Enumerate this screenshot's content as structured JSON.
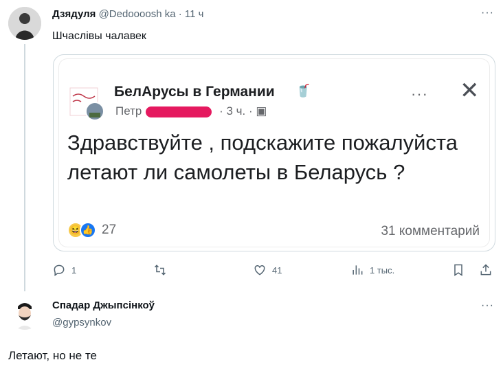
{
  "tweet1": {
    "name": "Дзядуля",
    "handle": "@Dedoooosh ka",
    "time": "11 ч",
    "text": "Шчаслівы чалавек",
    "more": "···"
  },
  "fb_post": {
    "group": "БелАрусы в Германии",
    "author": "Петр",
    "time": "3 ч.",
    "text": "Здравствуйте , подскажите пожалуйста летают ли самолеты в Беларусь ?",
    "reactions_count": "27",
    "comments": "31 комментарий",
    "dots": "···",
    "close": "✕"
  },
  "actions": {
    "replies": "1",
    "likes": "41",
    "views": "1 тыс."
  },
  "tweet2": {
    "name": "Спадар Джыпсінкоў",
    "handle": "@gypsynkov",
    "text": "Летают, но не те",
    "more": "···"
  },
  "icons": [
    "reply-icon",
    "retweet-icon",
    "like-icon",
    "views-icon",
    "bookmark-icon",
    "share-icon",
    "more-icon",
    "close-icon"
  ],
  "colors": {
    "text": "#0f1419",
    "muted": "#536471",
    "border": "#cfd9de",
    "redaction": "#e5195f"
  }
}
